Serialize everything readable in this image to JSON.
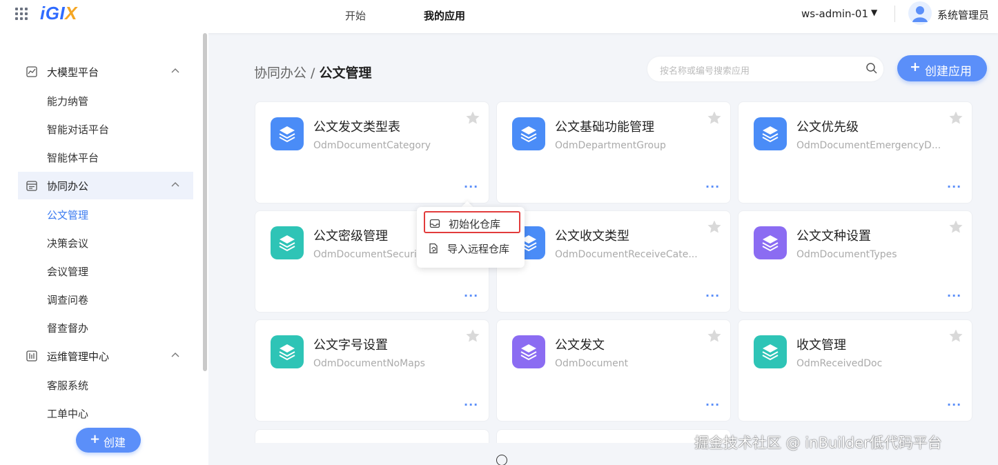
{
  "header": {
    "logo_main": "iGI",
    "logo_accent": "X",
    "tabs": [
      {
        "label": "开始",
        "active": false
      },
      {
        "label": "我的应用",
        "active": true
      }
    ],
    "workspace": "ws-admin-01",
    "workspace_caret": "▼",
    "user_name": "系统管理员"
  },
  "sidebar": {
    "groups": [
      {
        "label": "大模型平台",
        "icon": "chart-icon",
        "items": [
          "能力纳管",
          "智能对话平台",
          "智能体平台"
        ]
      },
      {
        "label": "协同办公",
        "icon": "calendar-icon",
        "active": true,
        "items": [
          "公文管理",
          "决策会议",
          "会议管理",
          "调查问卷",
          "督查督办"
        ],
        "selected": "公文管理"
      },
      {
        "label": "运维管理中心",
        "icon": "monitor-icon",
        "items": [
          "客服系统",
          "工单中心"
        ]
      }
    ],
    "create_button": "创建"
  },
  "main": {
    "breadcrumb_parent": "协同办公",
    "breadcrumb_sep": " / ",
    "breadcrumb_current": "公文管理",
    "search_placeholder": "按名称或编号搜索应用",
    "create_button": "创建应用",
    "more_label": "···",
    "cards": [
      {
        "title": "公文发文类型表",
        "subtitle": "OdmDocumentCategory",
        "color": "#4a8cf7"
      },
      {
        "title": "公文基础功能管理",
        "subtitle": "OdmDepartmentGroup",
        "color": "#4a8cf7"
      },
      {
        "title": "公文优先级",
        "subtitle": "OdmDocumentEmergencyD...",
        "color": "#4a8cf7"
      },
      {
        "title": "公文密级管理",
        "subtitle": "OdmDocumentSecurity",
        "color": "#2ec4b6"
      },
      {
        "title": "公文收文类型",
        "subtitle": "OdmDocumentReceiveCate...",
        "color": "#4a8cf7"
      },
      {
        "title": "公文文种设置",
        "subtitle": "OdmDocumentTypes",
        "color": "#8b6cf2"
      },
      {
        "title": "公文字号设置",
        "subtitle": "OdmDocumentNoMaps",
        "color": "#2ec4b6"
      },
      {
        "title": "公文发文",
        "subtitle": "OdmDocument",
        "color": "#8b6cf2"
      },
      {
        "title": "收文管理",
        "subtitle": "OdmReceivedDoc",
        "color": "#2ec4b6"
      }
    ]
  },
  "popup_menu": {
    "items": [
      {
        "label": "初始化仓库",
        "icon": "init-repo-icon",
        "highlighted": true
      },
      {
        "label": "导入远程仓库",
        "icon": "import-repo-icon",
        "highlighted": false
      }
    ]
  },
  "watermark": "掘金技术社区 @ inBuilder低代码平台"
}
